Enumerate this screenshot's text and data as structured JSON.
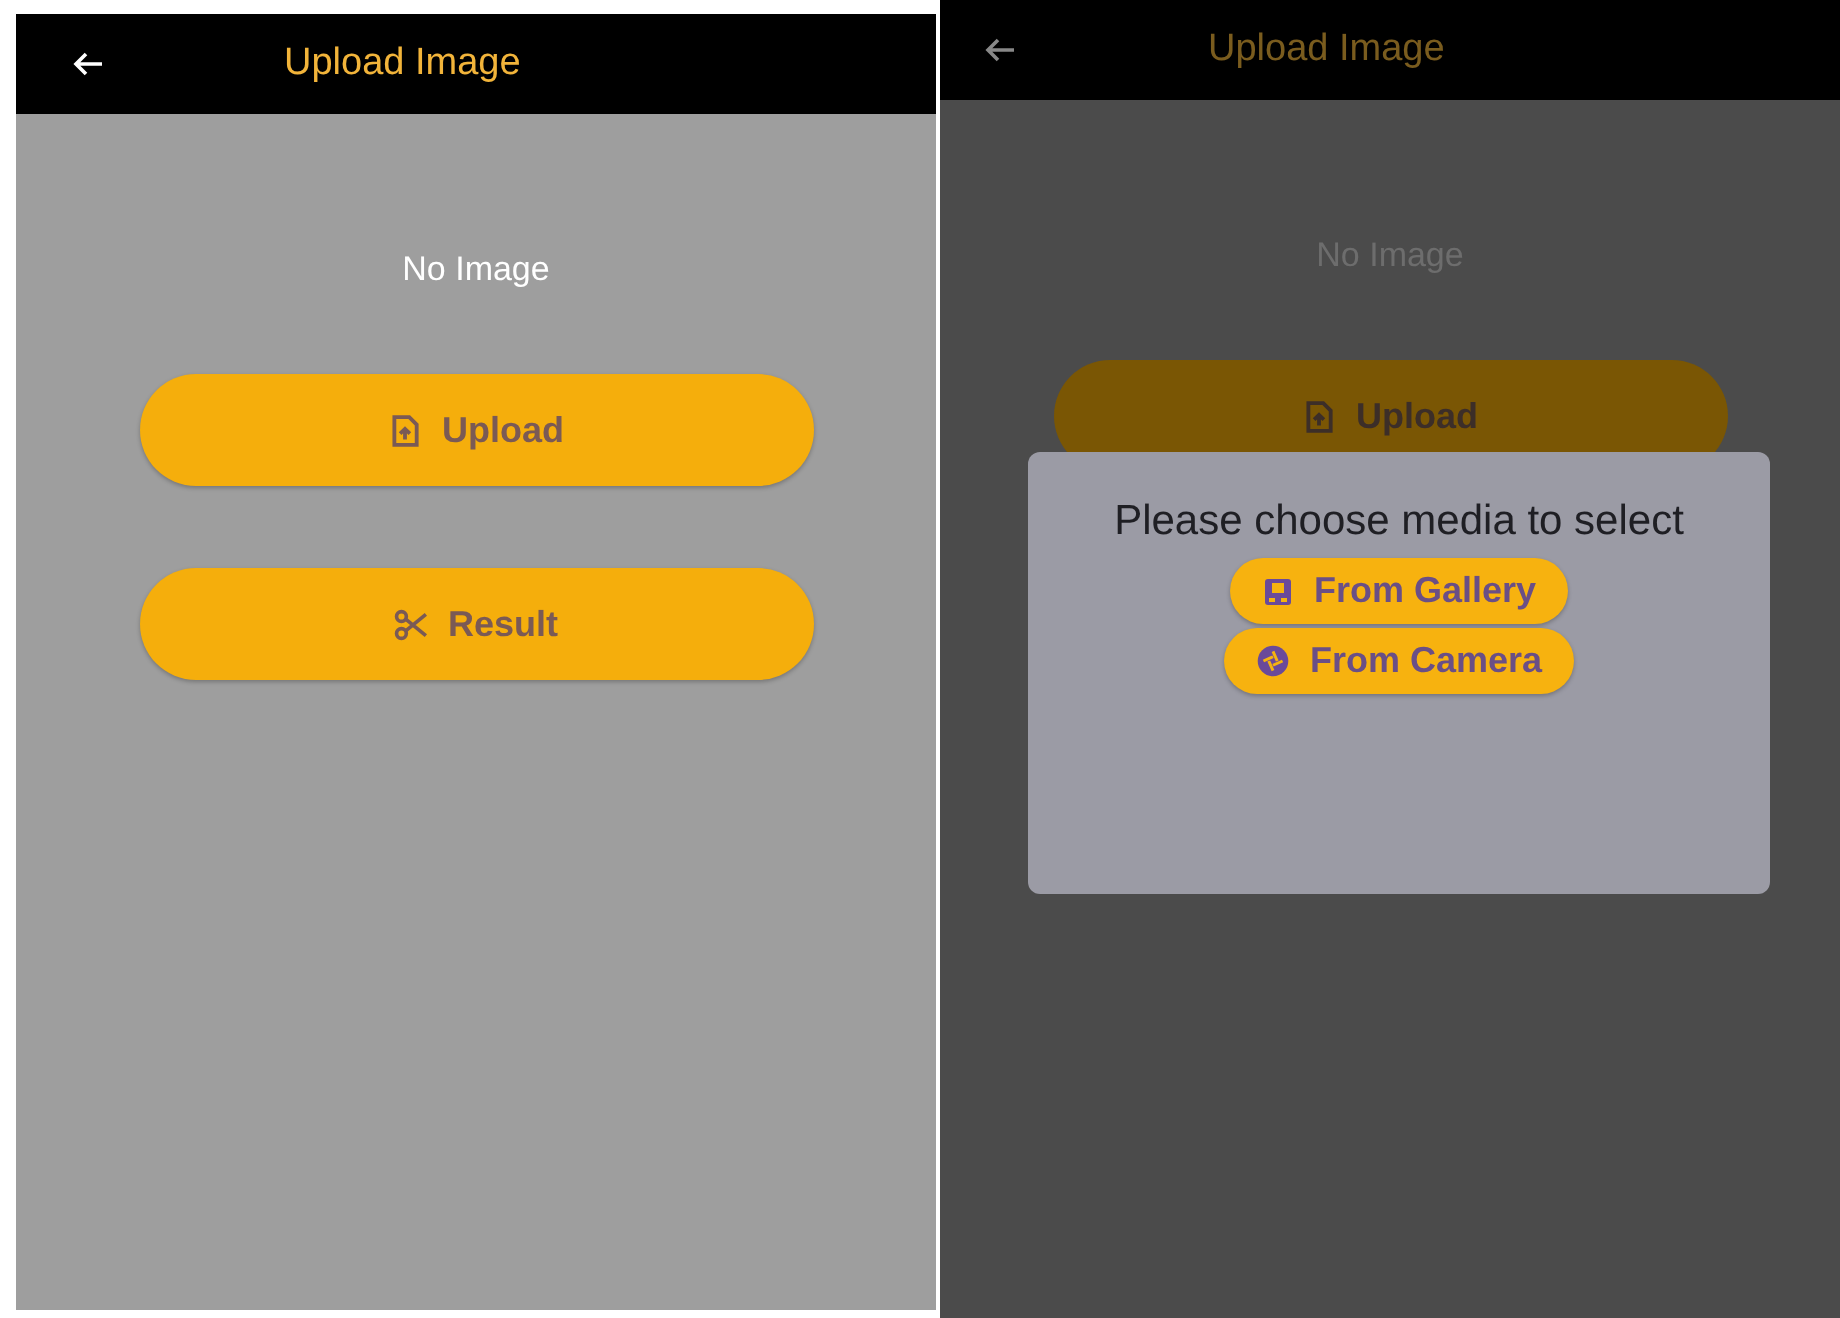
{
  "screens": [
    {
      "dimmed": false,
      "app_bar": {
        "title": "Upload Image"
      },
      "status_text": "No Image",
      "buttons": [
        {
          "label": "Upload",
          "kind": "upload"
        },
        {
          "label": "Result",
          "kind": "scissors"
        }
      ]
    },
    {
      "dimmed": true,
      "app_bar": {
        "title": "Upload Image"
      },
      "status_text": "No Image",
      "buttons": [
        {
          "label": "Upload",
          "kind": "upload"
        }
      ],
      "dialog": {
        "message": "Please choose media to select",
        "options": [
          {
            "label": "From Gallery",
            "kind": "gallery"
          },
          {
            "label": "From Camera",
            "kind": "camera"
          }
        ]
      }
    }
  ]
}
